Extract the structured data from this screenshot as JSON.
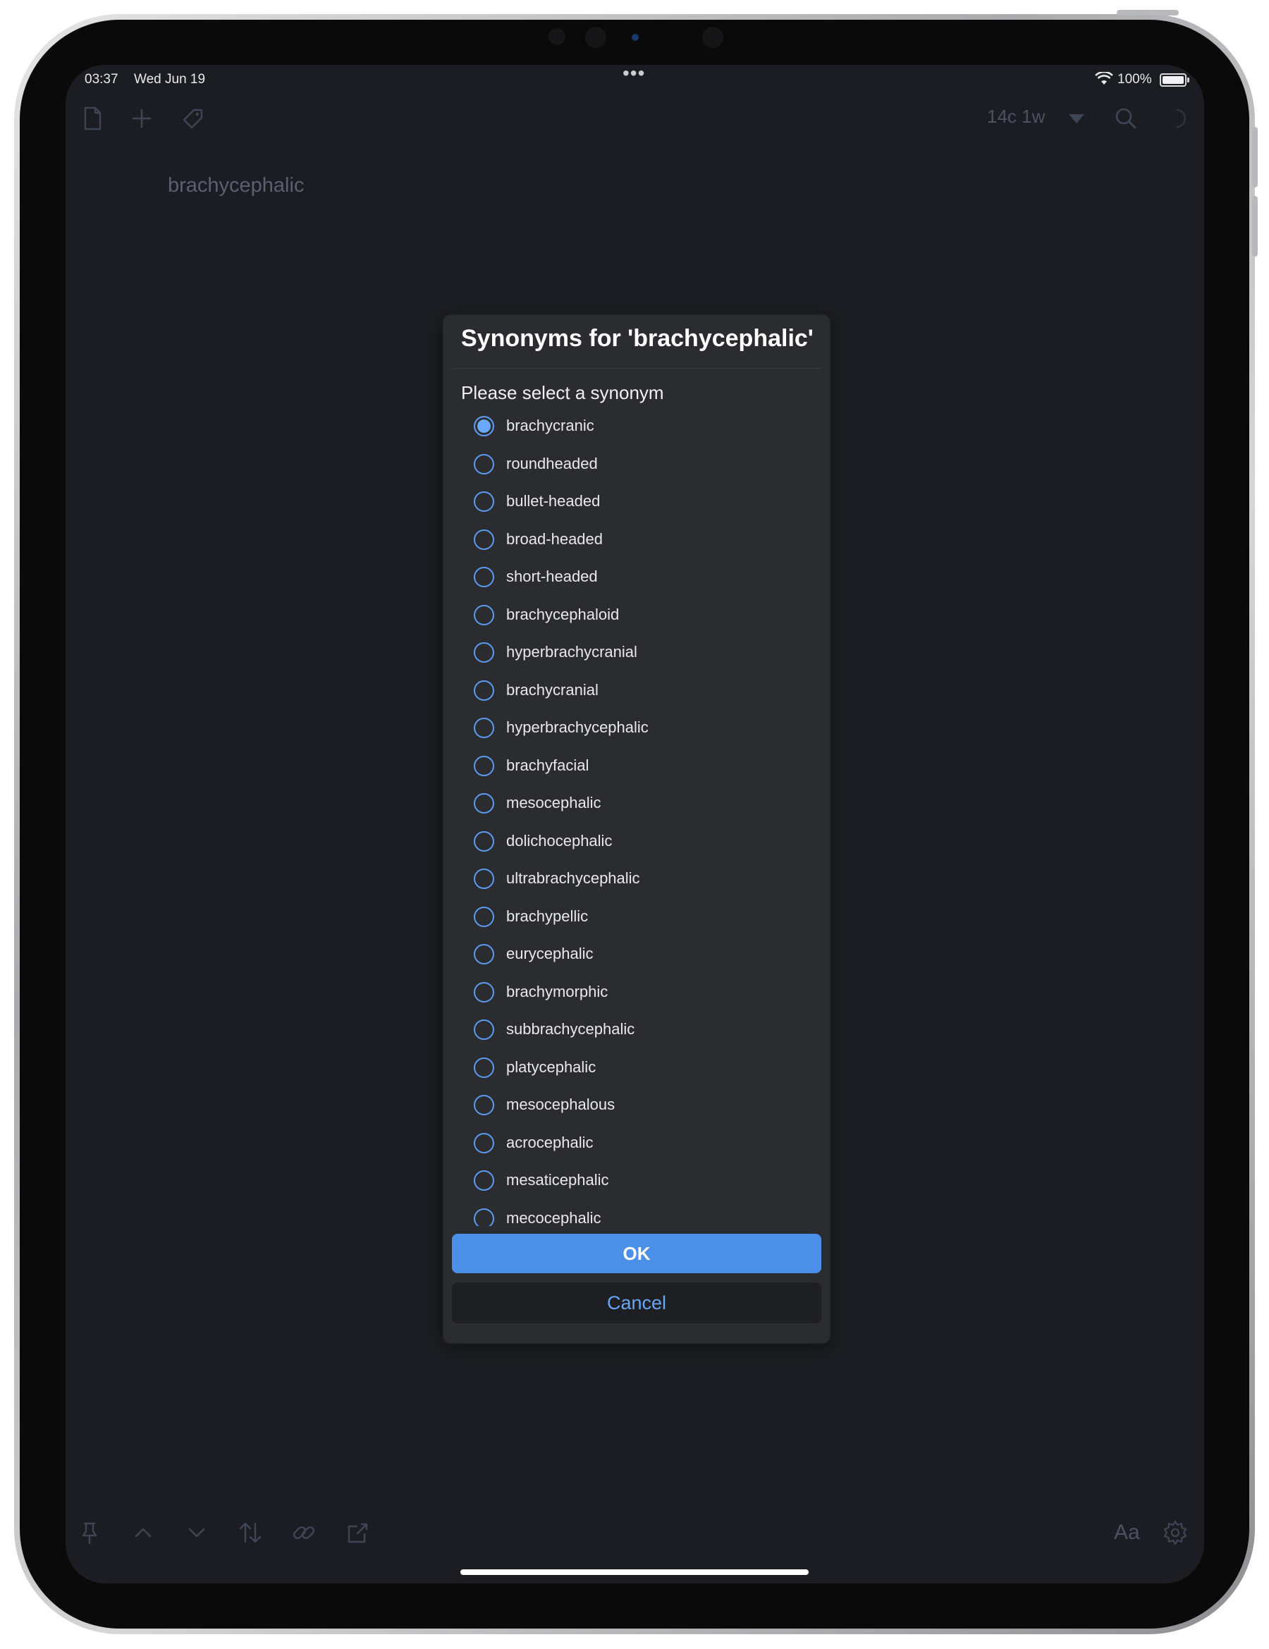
{
  "status_bar": {
    "time": "03:37",
    "date": "Wed Jun 19",
    "more": "•••",
    "battery_percent": "100%"
  },
  "toolbar": {
    "left_icons": [
      "document-icon",
      "plus-icon",
      "tag-icon"
    ],
    "counter": "14c 1w",
    "right_icons": [
      "triangle-down-icon",
      "search-icon",
      "sync-icon"
    ]
  },
  "document": {
    "text": "brachycephalic"
  },
  "dialog": {
    "title": "Synonyms for 'brachycephalic'",
    "prompt": "Please select a synonym",
    "selected_index": 0,
    "options": [
      "brachycranic",
      "roundheaded",
      "bullet-headed",
      "broad-headed",
      "short-headed",
      "brachycephaloid",
      "hyperbrachycranial",
      "brachycranial",
      "hyperbrachycephalic",
      "brachyfacial",
      "mesocephalic",
      "dolichocephalic",
      "ultrabrachycephalic",
      "brachypellic",
      "eurycephalic",
      "brachymorphic",
      "subbrachycephalic",
      "platycephalic",
      "mesocephalous",
      "acrocephalic",
      "mesaticephalic",
      "mecocephalic"
    ],
    "ok_label": "OK",
    "cancel_label": "Cancel"
  },
  "bottom_toolbar": {
    "left_icons": [
      "pin-icon",
      "chevron-up-icon",
      "chevron-down-icon",
      "sort-icon",
      "link-icon",
      "share-icon"
    ],
    "font_label": "Aa",
    "right_icon": "gear-icon"
  },
  "colors": {
    "accent": "#4a8fe8",
    "background": "#1b1d22",
    "dialog": "#2b2c30",
    "icon": "#3e4656"
  }
}
